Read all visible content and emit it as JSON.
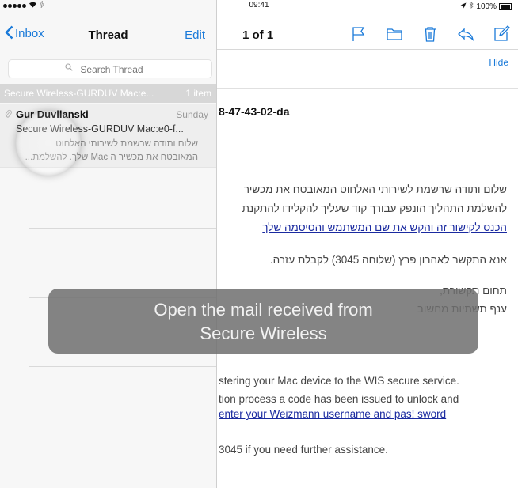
{
  "status_bar": {
    "time": "09:41",
    "battery": "100%"
  },
  "left_pane": {
    "back_label": "Inbox",
    "title": "Thread",
    "edit_label": "Edit",
    "search_placeholder": "Search Thread",
    "thread_header": {
      "subject": "Secure Wireless-GURDUV Mac:e...",
      "count": "1 item"
    },
    "message": {
      "sender": "Gur Duvilanski",
      "date": "Sunday",
      "subject": "Secure Wireless-GURDUV Mac:e0-f...",
      "preview_line1": "שלום ותודה שרשמת לשירותי האלחוט",
      "preview_line2": "המאובטח את מכשיר ה Mac שלך. להשלמת..."
    }
  },
  "right_pane": {
    "pager": "1 of 1",
    "hide_label": "Hide",
    "mac_fragment": "8-47-43-02-da",
    "hebrew": {
      "line1": "שלום ותודה שרשמת לשירותי האלחוט המאובטח את מכשיר",
      "line2": "להשלמת התהליך הונפק עבורך קוד שעליך להקלידו להתקנת",
      "link": "הכנס לקישור זה והקש את שם המשתמש והסיסמה שלך",
      "contact": "אנא התקשר לאהרון פרץ (שלוחה 3045) לקבלת עזרה.",
      "footer1": "תחום תקשורת,",
      "footer2": "ענף תשתיות מחשוב"
    },
    "english": {
      "line1": "stering your Mac device to the WIS secure service.",
      "line2": "tion process a code has been issued to unlock and",
      "link": "enter your Weizmann username and pas! sword",
      "contact": "3045 if you need further assistance."
    }
  },
  "overlay": {
    "line1": "Open the mail received from",
    "line2": "Secure Wireless"
  },
  "colors": {
    "accent": "#1a7ad9",
    "link": "#1a2aa0",
    "thread_header_bg": "#d7d7d7",
    "toast_bg": "#6e6e6e"
  }
}
